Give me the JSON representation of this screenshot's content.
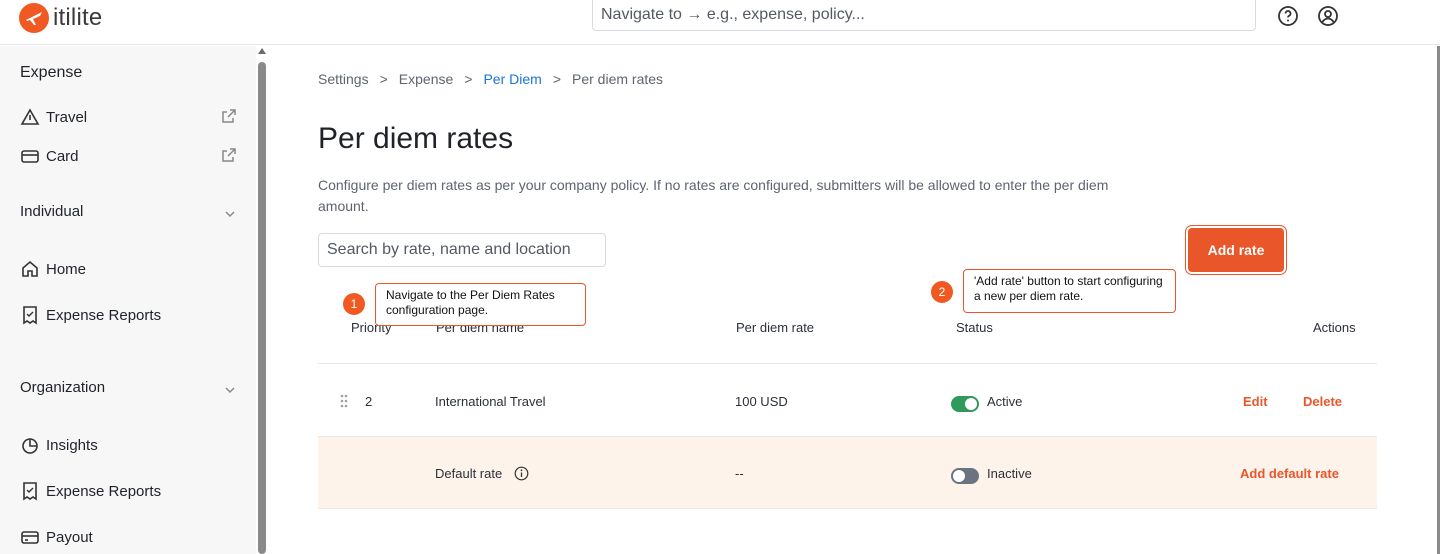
{
  "app": {
    "brand": "itilite"
  },
  "topbar": {
    "search_placeholder": "Navigate to → e.g., expense, policy..."
  },
  "sidebar": {
    "heading": "Expense",
    "quick_links": [
      {
        "label": "Travel",
        "icon": "triangle-icon"
      },
      {
        "label": "Card",
        "icon": "card-icon"
      }
    ],
    "sections": [
      {
        "label": "Individual",
        "items": [
          {
            "label": "Home",
            "icon": "home-icon"
          },
          {
            "label": "Expense Reports",
            "icon": "receipt-icon"
          }
        ]
      },
      {
        "label": "Organization",
        "items": [
          {
            "label": "Insights",
            "icon": "pie-chart-icon"
          },
          {
            "label": "Expense Reports",
            "icon": "receipt-icon"
          },
          {
            "label": "Payout",
            "icon": "wallet-icon"
          }
        ]
      }
    ]
  },
  "breadcrumb": [
    {
      "label": "Settings"
    },
    {
      "label": "Expense"
    },
    {
      "label": "Per Diem"
    },
    {
      "label": "Per diem rates"
    }
  ],
  "breadcrumb_separator": ">",
  "page": {
    "title": "Per diem rates",
    "description": "Configure per diem rates as per your company policy. If no rates are configured, submitters will be allowed to enter the per diem amount.",
    "search_placeholder": "Search by rate, name and location",
    "add_button": "Add rate"
  },
  "table": {
    "columns": [
      "Priority",
      "Per diem name",
      "Per diem rate",
      "Status",
      "Actions"
    ],
    "rows": [
      {
        "priority": "2",
        "name": "International Travel",
        "rate": "100 USD",
        "status": "Active",
        "actions": [
          "Edit",
          "Delete"
        ]
      }
    ],
    "default_row": {
      "name": "Default rate",
      "rate": "--",
      "status": "Inactive",
      "action": "Add default rate"
    }
  },
  "callouts": [
    {
      "number": "1",
      "text": "Navigate to the Per Diem Rates configuration page."
    },
    {
      "number": "2",
      "text": "'Add rate' button to start configuring a new per diem rate."
    }
  ],
  "colors": {
    "accent": "#e8562a",
    "active_toggle": "#2e9a5c",
    "inactive_toggle": "#6b7280",
    "link": "#1976d2"
  }
}
